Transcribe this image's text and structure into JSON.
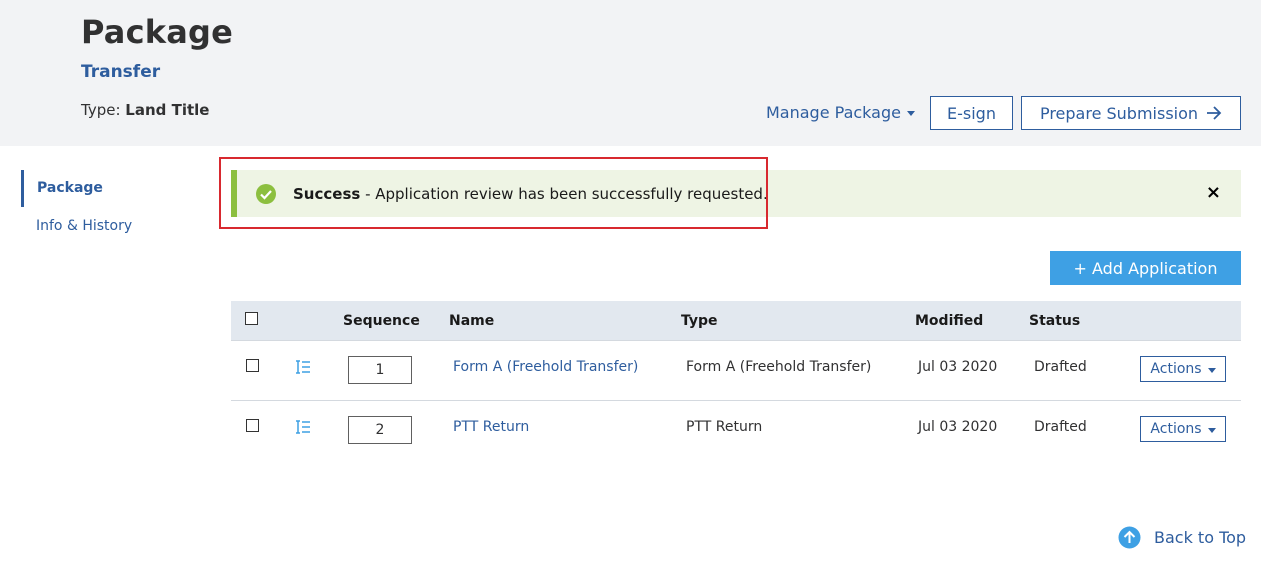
{
  "header": {
    "title": "Package",
    "subtitle": "Transfer",
    "type_label": "Type:",
    "type_value": "Land Title",
    "manage_package_label": "Manage Package",
    "esign_label": "E-sign",
    "prepare_submission_label": "Prepare Submission"
  },
  "sidebar": {
    "items": [
      {
        "label": "Package",
        "active": true
      },
      {
        "label": "Info & History",
        "active": false
      }
    ]
  },
  "alert": {
    "title": "Success",
    "message": " - Application review has been successfully requested.",
    "close_symbol": "×",
    "icon": "check-circle-icon",
    "color": "#8cbf3f"
  },
  "add_application_label": "+ Add Application",
  "table": {
    "columns": [
      "Sequence",
      "Name",
      "Type",
      "Modified",
      "Status"
    ],
    "rows": [
      {
        "sequence": "1",
        "name": "Form A (Freehold Transfer)",
        "type": "Form A (Freehold Transfer)",
        "modified": "Jul 03 2020",
        "status": "Drafted",
        "actions_label": "Actions"
      },
      {
        "sequence": "2",
        "name": "PTT Return",
        "type": "PTT Return",
        "modified": "Jul 03 2020",
        "status": "Drafted",
        "actions_label": "Actions"
      }
    ]
  },
  "back_to_top_label": "Back to Top",
  "colors": {
    "primary": "#2e5d9e",
    "accent_button": "#3ea0e4",
    "highlight": "#d8292f"
  }
}
